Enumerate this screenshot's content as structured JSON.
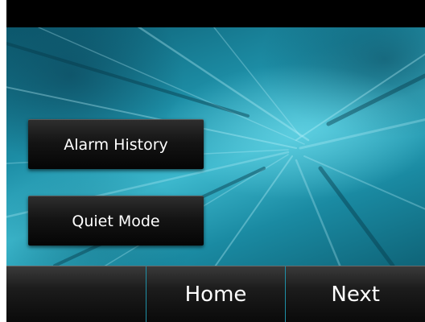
{
  "menu": {
    "alarm_history_label": "Alarm History",
    "quiet_mode_label": "Quiet Mode"
  },
  "softkeys": {
    "left_label": "",
    "home_label": "Home",
    "next_label": "Next"
  },
  "colors": {
    "screen_background": "#000000",
    "wallpaper_teal": "#1d8ea6",
    "button_text": "#ffffff",
    "softkey_divider": "#1f8fa6"
  }
}
